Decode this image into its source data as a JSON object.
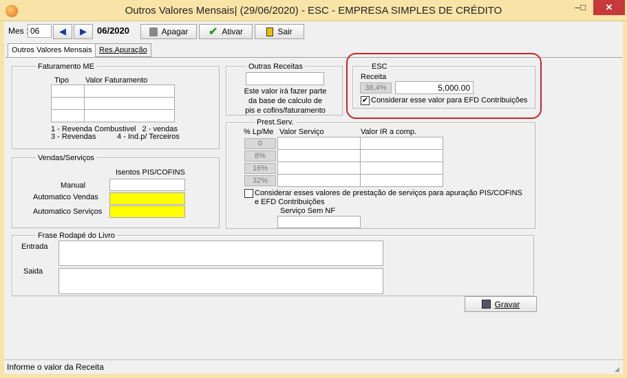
{
  "window": {
    "title": "Outros Valores Mensais| (29/06/2020) - ESC - EMPRESA SIMPLES DE CRÉDITO",
    "minimize": "–",
    "maximize": "□",
    "close": "✕"
  },
  "toolbar": {
    "mes_label": "Mes :",
    "mes_value": "06",
    "period": "06/2020",
    "apagar": "Apagar",
    "ativar": "Ativar",
    "sair": "Sair"
  },
  "tabs": [
    "Outros Valores Mensais",
    "Res.Apuração"
  ],
  "faturamento": {
    "legend": "Faturamento  ME",
    "col_tipo": "Tipo",
    "col_valor": "Valor Faturamento",
    "note1": "1 - Revenda Combustivel   2 - vendas",
    "note2": "3 - Revendas          4 - Ind.p/ Terceiros"
  },
  "vendas": {
    "legend": "Vendas/Serviços",
    "isentos": "Isentos PIS/COFINS",
    "manual": "Manual",
    "auto_vendas": "Automatico Vendas",
    "auto_servicos": "Automatico Serviços"
  },
  "outras": {
    "legend": "Outras Receitas",
    "note1": "Este valor irá fazer parte",
    "note2": "da base de calculo de",
    "note3": "pis e cofins/faturamento"
  },
  "esc": {
    "legend": "ESC",
    "receita_label": "Receita",
    "percent": "38,4%",
    "value": "5,000.00",
    "checkbox_label": "Considerar esse valor para EFD Contribuições",
    "checked": "✔",
    "highlight_color": "#c8222a"
  },
  "prest": {
    "legend": "Prest.Serv.",
    "col_lp": "% Lp/Me",
    "col_valor": "Valor Serviço",
    "col_ir": "Valor IR a comp.",
    "rates": [
      "0",
      "8%",
      "16%",
      "32%"
    ],
    "checkbox_label1": "Considerar esses valores de prestação de serviços para apuração PIS/COFINS",
    "checkbox_label2": "e EFD Contribuições",
    "sem_nf": "Serviço Sem NF"
  },
  "rodape": {
    "legend": "Frase Rodapé do Livro",
    "entrada": "Entrada",
    "saida": "Saida"
  },
  "gravar": "Gravar",
  "status": "Informe o valor da Receita"
}
